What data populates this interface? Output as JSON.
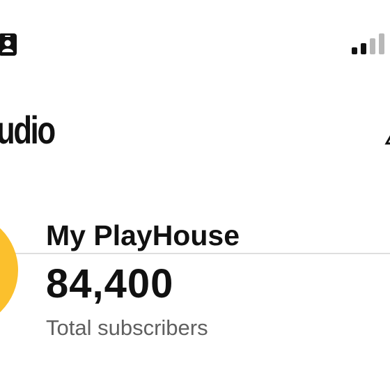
{
  "status_bar": {
    "left_icon": "contact-card-icon",
    "right_icon": "cellular-signal-icon",
    "signal_bars_active": 2,
    "signal_bars_total": 4
  },
  "header": {
    "title": "udio",
    "right_icon": "partial-icon"
  },
  "channel": {
    "avatar_color": "#fbc02d",
    "name": "My PlayHouse",
    "subscriber_count": "84,400",
    "subscriber_label": "Total subscribers"
  }
}
